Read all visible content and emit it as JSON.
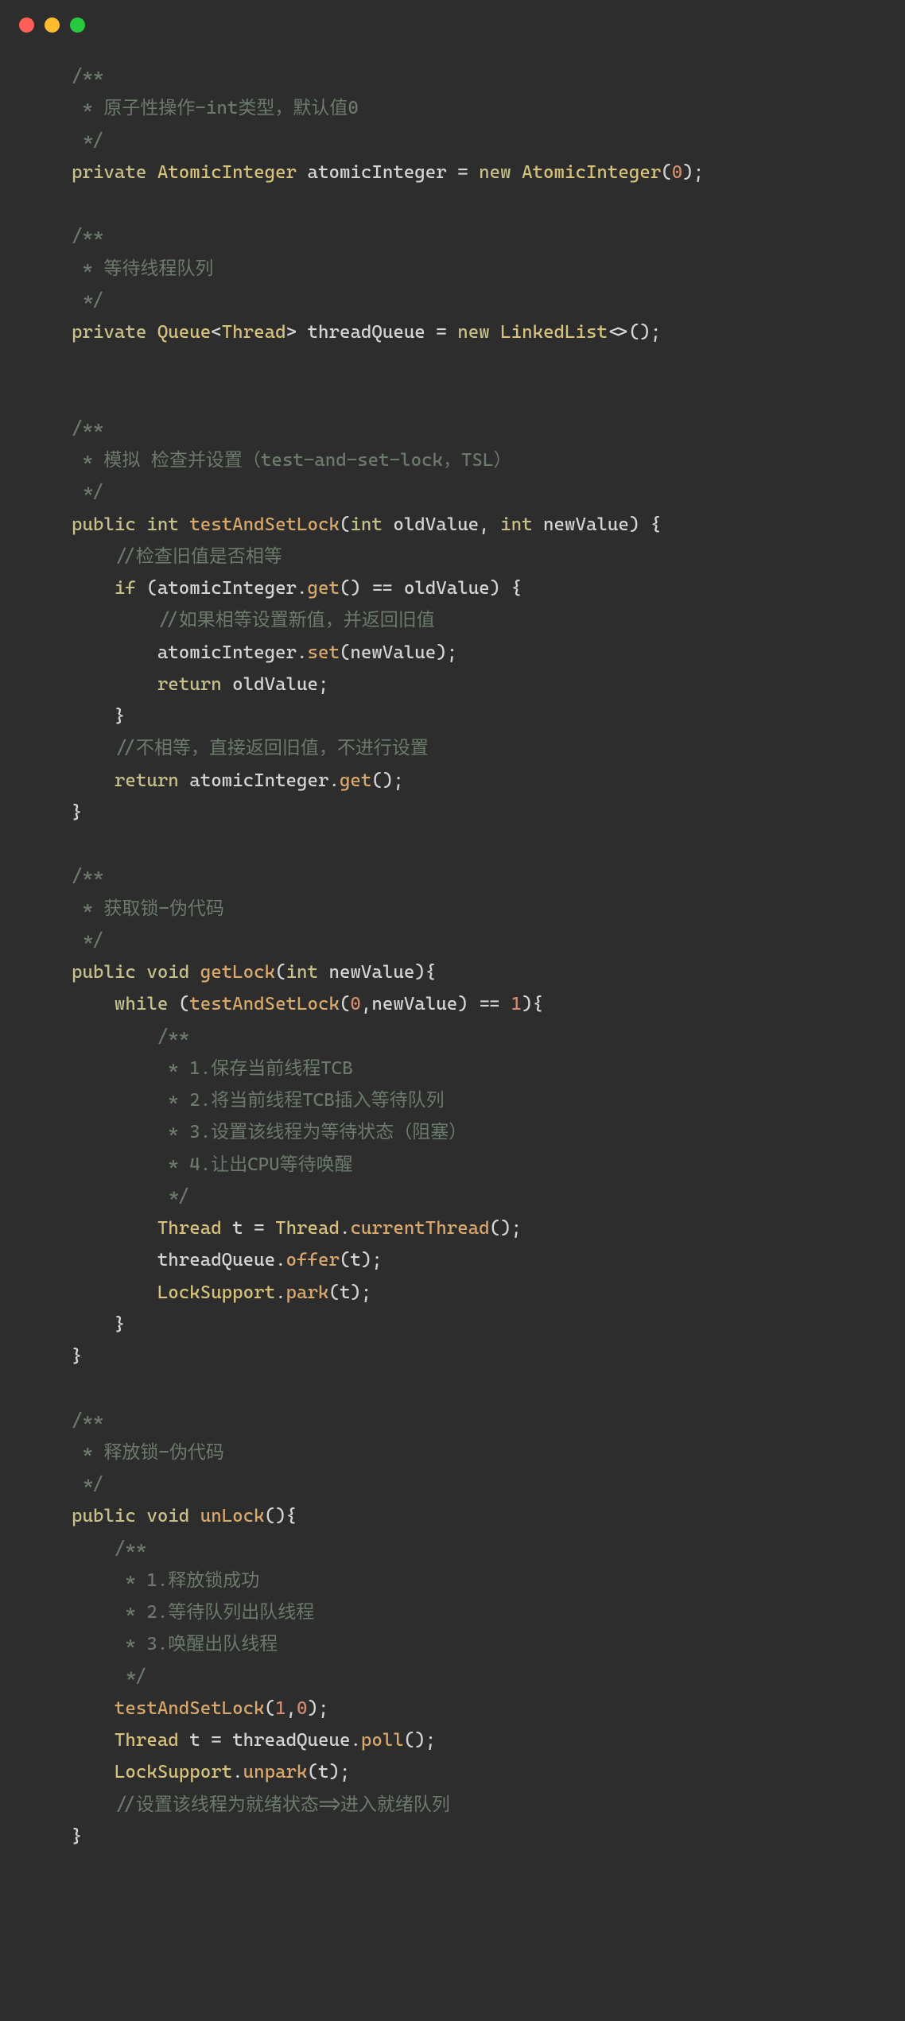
{
  "l1": "/**",
  "l2": " * 原子性操作-int类型，默认值0",
  "l3": " */",
  "l4a": "private",
  "l4b": "AtomicInteger",
  "l4c": "atomicInteger",
  "l4d": "=",
  "l4e": "new",
  "l4f": "AtomicInteger",
  "l4g": "0",
  "l6": "/**",
  "l7": " * 等待线程队列",
  "l8": " */",
  "l9a": "private",
  "l9b": "Queue",
  "l9c": "Thread",
  "l9d": "threadQueue",
  "l9e": "=",
  "l9f": "new",
  "l9g": "LinkedList",
  "l12": "/**",
  "l13": " * 模拟 检查并设置（test-and-set-lock，TSL）",
  "l14": " */",
  "l15a": "public",
  "l15b": "int",
  "l15c": "testAndSetLock",
  "l15d": "int",
  "l15e": "oldValue",
  "l15f": "int",
  "l15g": "newValue",
  "l16": "    //检查旧值是否相等",
  "l17a": "if",
  "l17b": "atomicInteger",
  "l17c": "get",
  "l17d": "==",
  "l17e": "oldValue",
  "l18": "        //如果相等设置新值，并返回旧值",
  "l19a": "atomicInteger",
  "l19b": "set",
  "l19c": "newValue",
  "l20a": "return",
  "l20b": "oldValue",
  "l21": "    }",
  "l22": "    //不相等，直接返回旧值，不进行设置",
  "l23a": "return",
  "l23b": "atomicInteger",
  "l23c": "get",
  "l24": "}",
  "l26": "/**",
  "l27": " * 获取锁-伪代码",
  "l28": " */",
  "l29a": "public",
  "l29b": "void",
  "l29c": "getLock",
  "l29d": "int",
  "l29e": "newValue",
  "l30a": "while",
  "l30b": "testAndSetLock",
  "l30c": "0",
  "l30d": "newValue",
  "l30e": "==",
  "l30f": "1",
  "l31": "        /**",
  "l32": "         * 1.保存当前线程TCB",
  "l33": "         * 2.将当前线程TCB插入等待队列",
  "l34": "         * 3.设置该线程为等待状态（阻塞）",
  "l35": "         * 4.让出CPU等待唤醒",
  "l36": "         */",
  "l37a": "Thread",
  "l37b": "t",
  "l37c": "=",
  "l37d": "Thread",
  "l37e": "currentThread",
  "l38a": "threadQueue",
  "l38b": "offer",
  "l38c": "t",
  "l39a": "LockSupport",
  "l39b": "park",
  "l39c": "t",
  "l40": "    }",
  "l41": "}",
  "l43": "/**",
  "l44": " * 释放锁-伪代码",
  "l45": " */",
  "l46a": "public",
  "l46b": "void",
  "l46c": "unLock",
  "l47": "    /**",
  "l48": "     * 1.释放锁成功",
  "l49": "     * 2.等待队列出队线程",
  "l50": "     * 3.唤醒出队线程",
  "l51": "     */",
  "l52a": "testAndSetLock",
  "l52b": "1",
  "l52c": "0",
  "l53a": "Thread",
  "l53b": "t",
  "l53c": "=",
  "l53d": "threadQueue",
  "l53e": "poll",
  "l54a": "LockSupport",
  "l54b": "unpark",
  "l54c": "t",
  "l55": "    //设置该线程为就绪状态=>进入就绪队列",
  "l56": "}"
}
